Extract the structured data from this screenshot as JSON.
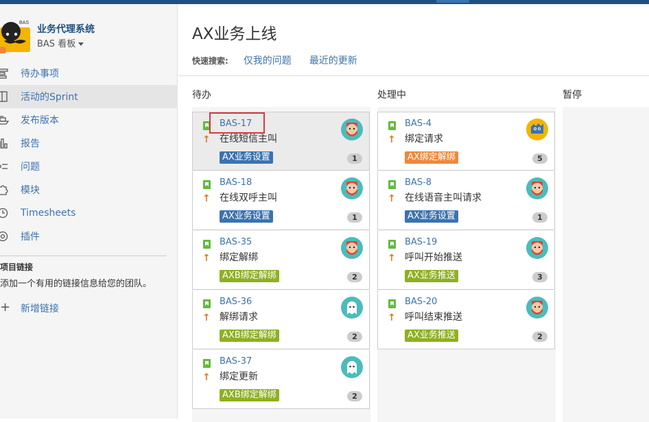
{
  "colors": {
    "topbar": "#205081",
    "link": "#3b73af",
    "story_icon": "#63ba3c",
    "priority": "#e07b29",
    "epic_blue": "#3b73af",
    "epic_orange": "#f0883a",
    "epic_green": "#8eb021",
    "highlight": "#d9363e"
  },
  "sidebar": {
    "project_name": "业务代理系统",
    "board_name": "BAS 看板",
    "avatar_text": "BAS",
    "items": [
      {
        "label": "待办事项",
        "icon": "backlog-icon"
      },
      {
        "label": "活动的Sprint",
        "icon": "sprint-board-icon"
      },
      {
        "label": "发布版本",
        "icon": "ship-icon"
      },
      {
        "label": "报告",
        "icon": "bar-chart-icon"
      },
      {
        "label": "问题",
        "icon": "issues-list-icon"
      },
      {
        "label": "模块",
        "icon": "puzzle-icon"
      },
      {
        "label": "Timesheets",
        "icon": "clock-icon"
      },
      {
        "label": "插件",
        "icon": "plugin-icon"
      }
    ],
    "links_title": "项目链接",
    "links_desc": "添加一个有用的链接信息给您的团队。",
    "add_link": "新增链接",
    "add_icon": "+"
  },
  "board": {
    "title": "AX业务上线",
    "quick_filter_label": "快速搜索:",
    "quick_filters": [
      "仅我的问题",
      "最近的更新"
    ],
    "columns": [
      {
        "name": "待办",
        "cards": [
          {
            "key": "BAS-17",
            "summary": "在线短信主叫",
            "epic": "AX业务设置",
            "epic_color": "#3b73af",
            "count": "1",
            "avatar": "redbeard"
          },
          {
            "key": "BAS-18",
            "summary": "在线双呼主叫",
            "epic": "AX业务设置",
            "epic_color": "#3b73af",
            "count": "1",
            "avatar": "redbeard"
          },
          {
            "key": "BAS-35",
            "summary": "绑定解绑",
            "epic": "AXB绑定解绑",
            "epic_color": "#8eb021",
            "count": "2",
            "avatar": "redbeard"
          },
          {
            "key": "BAS-36",
            "summary": "解绑请求",
            "epic": "AXB绑定解绑",
            "epic_color": "#8eb021",
            "count": "2",
            "avatar": "ghost"
          },
          {
            "key": "BAS-37",
            "summary": "绑定更新",
            "epic": "AXB绑定解绑",
            "epic_color": "#8eb021",
            "count": "2",
            "avatar": "ghost"
          }
        ]
      },
      {
        "name": "处理中",
        "cards": [
          {
            "key": "BAS-4",
            "summary": "绑定请求",
            "epic": "AX绑定解绑",
            "epic_color": "#f0883a",
            "count": "5",
            "avatar": "blueblob"
          },
          {
            "key": "BAS-8",
            "summary": "在线语音主叫请求",
            "epic": "AX业务设置",
            "epic_color": "#3b73af",
            "count": "1",
            "avatar": "redbeard"
          },
          {
            "key": "BAS-19",
            "summary": "呼叫开始推送",
            "epic": "AX业务推送",
            "epic_color": "#8eb021",
            "count": "3",
            "avatar": "redbeard"
          },
          {
            "key": "BAS-20",
            "summary": "呼叫结束推送",
            "epic": "AX业务推送",
            "epic_color": "#8eb021",
            "count": "2",
            "avatar": "redbeard"
          }
        ]
      },
      {
        "name": "暂停",
        "cards": []
      }
    ]
  }
}
